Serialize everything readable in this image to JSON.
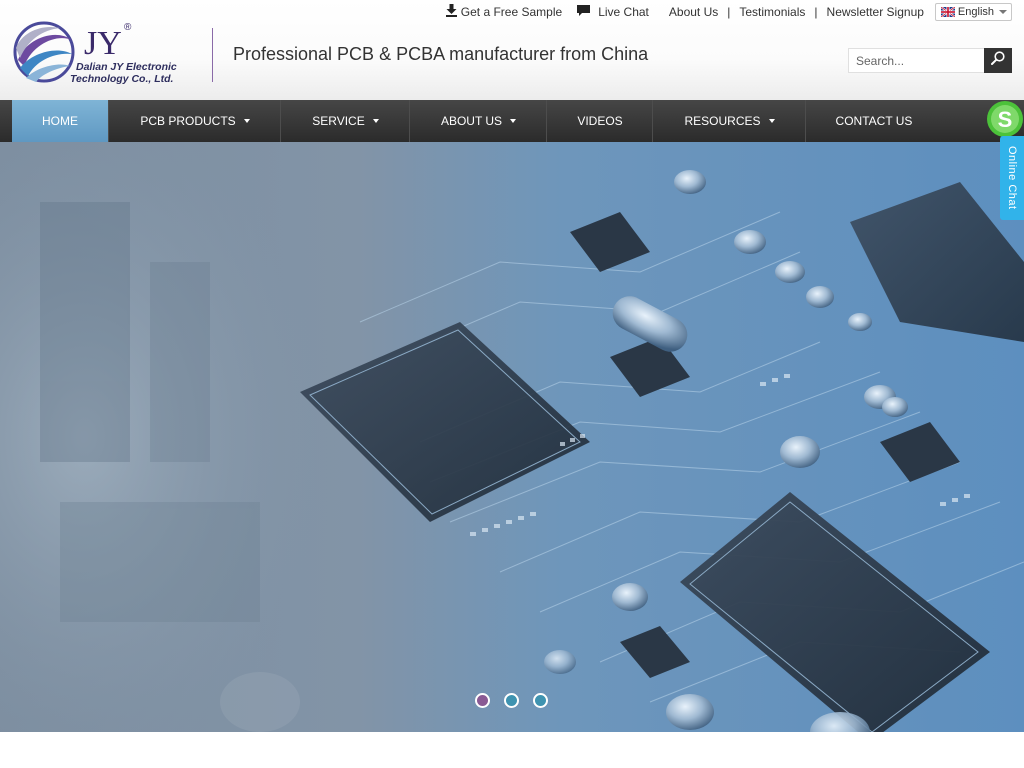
{
  "header": {
    "logo": {
      "letters": "JY",
      "registered": "®",
      "company_line1": "Dalian JY Electronic",
      "company_line2": "Technology Co., Ltd."
    },
    "tagline": "Professional PCB & PCBA manufacturer from China",
    "topbar": {
      "free_sample": "Get a Free Sample",
      "live_chat": "Live Chat",
      "about_us": "About Us",
      "sep": "|",
      "testimonials": "Testimonials",
      "newsletter": "Newsletter Signup",
      "language": "English"
    },
    "search": {
      "placeholder": "Search..."
    }
  },
  "nav": {
    "items": [
      {
        "label": "HOME",
        "active": true,
        "dropdown": false
      },
      {
        "label": "PCB PRODUCTS",
        "active": false,
        "dropdown": true
      },
      {
        "label": "SERVICE",
        "active": false,
        "dropdown": true
      },
      {
        "label": "ABOUT US",
        "active": false,
        "dropdown": true
      },
      {
        "label": "VIDEOS",
        "active": false,
        "dropdown": false
      },
      {
        "label": "RESOURCES",
        "active": false,
        "dropdown": true
      },
      {
        "label": "CONTACT US",
        "active": false,
        "dropdown": false
      }
    ]
  },
  "chat": {
    "label": "Online Chat"
  },
  "hero": {
    "slides": 3,
    "active_slide": 1,
    "dot_colors": [
      "#8a5a94",
      "#3f93b0",
      "#3f93b0"
    ]
  },
  "colors": {
    "nav_bg": "#333333",
    "nav_active": "#6fa6cc",
    "chat_green": "#4cc23a",
    "chat_blue": "#31b3ea",
    "logo_purple": "#5b3b8c"
  }
}
